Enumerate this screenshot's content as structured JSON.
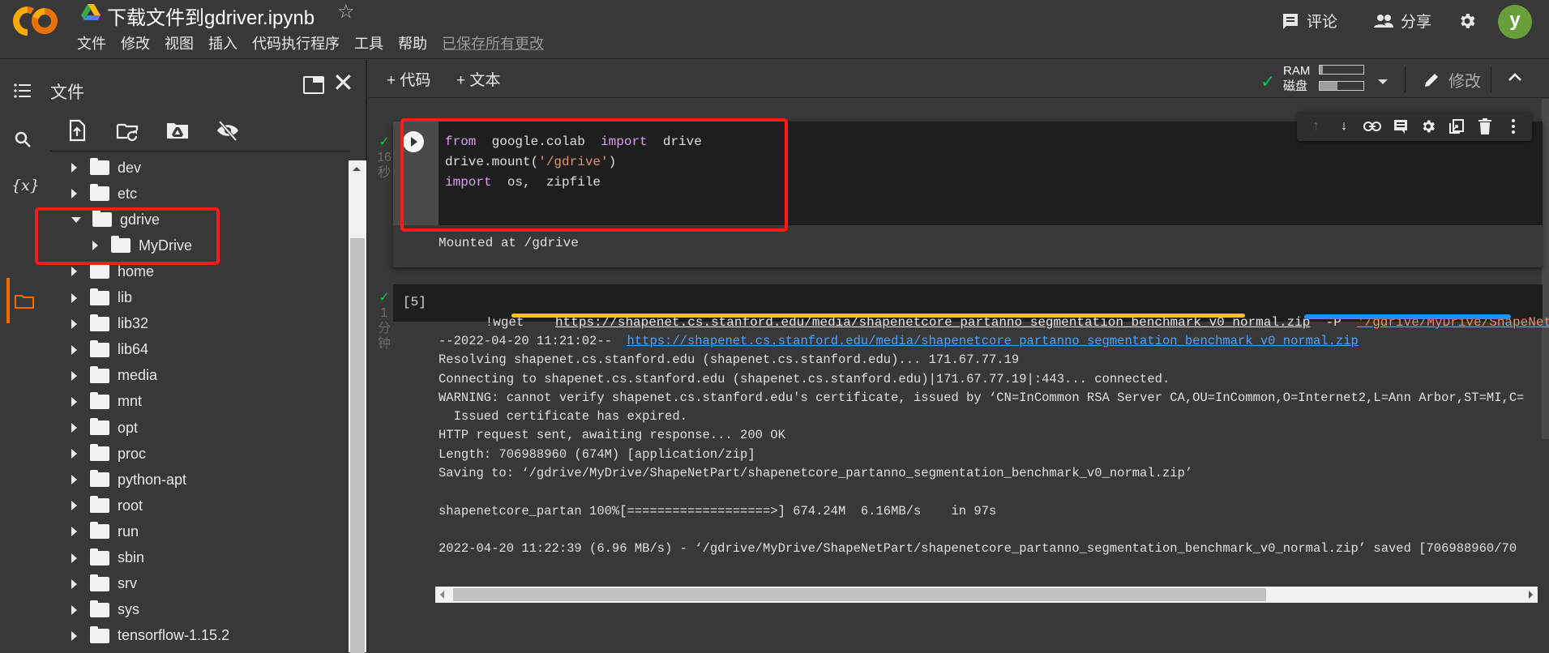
{
  "header": {
    "logo": "colab-logo",
    "title": "下载文件到gdriver.ipynb",
    "menu": [
      "文件",
      "修改",
      "视图",
      "插入",
      "代码执行程序",
      "工具",
      "帮助"
    ],
    "saved_status": "已保存所有更改",
    "comment_label": "评论",
    "share_label": "分享",
    "avatar_letter": "y"
  },
  "sidebar": {
    "panel_title": "文件",
    "rail_icons": [
      "table-of-contents-icon",
      "search-icon",
      "variables-icon",
      "files-icon"
    ],
    "tools": [
      "upload-icon",
      "refresh-icon",
      "mount-drive-icon",
      "hide-icon"
    ],
    "tree": [
      {
        "name": "dev",
        "expanded": false,
        "depth": 0
      },
      {
        "name": "etc",
        "expanded": false,
        "depth": 0
      },
      {
        "name": "gdrive",
        "expanded": true,
        "depth": 0
      },
      {
        "name": "MyDrive",
        "expanded": false,
        "depth": 1
      },
      {
        "name": "home",
        "expanded": false,
        "depth": 0
      },
      {
        "name": "lib",
        "expanded": false,
        "depth": 0
      },
      {
        "name": "lib32",
        "expanded": false,
        "depth": 0
      },
      {
        "name": "lib64",
        "expanded": false,
        "depth": 0
      },
      {
        "name": "media",
        "expanded": false,
        "depth": 0
      },
      {
        "name": "mnt",
        "expanded": false,
        "depth": 0
      },
      {
        "name": "opt",
        "expanded": false,
        "depth": 0
      },
      {
        "name": "proc",
        "expanded": false,
        "depth": 0
      },
      {
        "name": "python-apt",
        "expanded": false,
        "depth": 0
      },
      {
        "name": "root",
        "expanded": false,
        "depth": 0
      },
      {
        "name": "run",
        "expanded": false,
        "depth": 0
      },
      {
        "name": "sbin",
        "expanded": false,
        "depth": 0
      },
      {
        "name": "srv",
        "expanded": false,
        "depth": 0
      },
      {
        "name": "sys",
        "expanded": false,
        "depth": 0
      },
      {
        "name": "tensorflow-1.15.2",
        "expanded": false,
        "depth": 0
      }
    ]
  },
  "toolbar": {
    "add_code": "+ 代码",
    "add_text": "+ 文本",
    "ram_label": "RAM",
    "disk_label": "磁盘",
    "ram_usage": 0.07,
    "disk_usage": 0.4,
    "edit_label": "修改"
  },
  "cell_toolbar": [
    "move-up-icon",
    "move-down-icon",
    "link-icon",
    "comment-icon",
    "settings-icon",
    "mirror-cell-icon",
    "delete-icon",
    "more-icon"
  ],
  "cells": [
    {
      "exec_time_value": "16",
      "exec_time_unit": "秒",
      "code_lines": [
        [
          {
            "t": "from",
            "c": "kw"
          },
          {
            "t": "  google.colab  ",
            "c": "plain"
          },
          {
            "t": "import",
            "c": "kw"
          },
          {
            "t": "  drive",
            "c": "plain"
          }
        ],
        [
          {
            "t": "drive.mount(",
            "c": "plain"
          },
          {
            "t": "'/gdrive'",
            "c": "str"
          },
          {
            "t": ")",
            "c": "plain"
          }
        ],
        [
          {
            "t": "import",
            "c": "kw"
          },
          {
            "t": "  os,  zipfile",
            "c": "plain"
          }
        ]
      ],
      "output": "Mounted at /gdrive"
    },
    {
      "exec_count": "[5]",
      "exec_time_value": "1",
      "exec_time_unit1": "分",
      "exec_time_unit2": "钟",
      "cmd": "!wget",
      "url": "https://shapenet.cs.stanford.edu/media/shapenetcore_partanno_segmentation_benchmark_v0_normal.zip",
      "flag": "-P",
      "dest": "'/gdrive/MyDrive/ShapeNetPart'",
      "output_lines": [
        {
          "prefix": "--2022-04-20 11:21:02--  ",
          "link": "https://shapenet.cs.stanford.edu/media/shapenetcore_partanno_segmentation_benchmark_v0_normal.zip"
        },
        {
          "text": "Resolving shapenet.cs.stanford.edu (shapenet.cs.stanford.edu)... 171.67.77.19"
        },
        {
          "text": "Connecting to shapenet.cs.stanford.edu (shapenet.cs.stanford.edu)|171.67.77.19|:443... connected."
        },
        {
          "text": "WARNING: cannot verify shapenet.cs.stanford.edu's certificate, issued by ‘CN=InCommon RSA Server CA,OU=InCommon,O=Internet2,L=Ann Arbor,ST=MI,C="
        },
        {
          "text": "  Issued certificate has expired."
        },
        {
          "text": "HTTP request sent, awaiting response... 200 OK"
        },
        {
          "text": "Length: 706988960 (674M) [application/zip]"
        },
        {
          "text": "Saving to: ‘/gdrive/MyDrive/ShapeNetPart/shapenetcore_partanno_segmentation_benchmark_v0_normal.zip’"
        },
        {
          "text": ""
        },
        {
          "text": "shapenetcore_partan 100%[===================>] 674.24M  6.16MB/s    in 97s"
        },
        {
          "text": ""
        },
        {
          "text": "2022-04-20 11:22:39 (6.96 MB/s) - ‘/gdrive/MyDrive/ShapeNetPart/shapenetcore_partanno_segmentation_benchmark_v0_normal.zip’ saved [706988960/70"
        }
      ]
    }
  ],
  "colors": {
    "accent_orange": "#ef6c00",
    "annotation_red": "#ff1a1a",
    "annotation_yellow": "#ffc107",
    "annotation_blue": "#1e90ff",
    "success_green": "#00c853",
    "avatar_green": "#689f38"
  }
}
